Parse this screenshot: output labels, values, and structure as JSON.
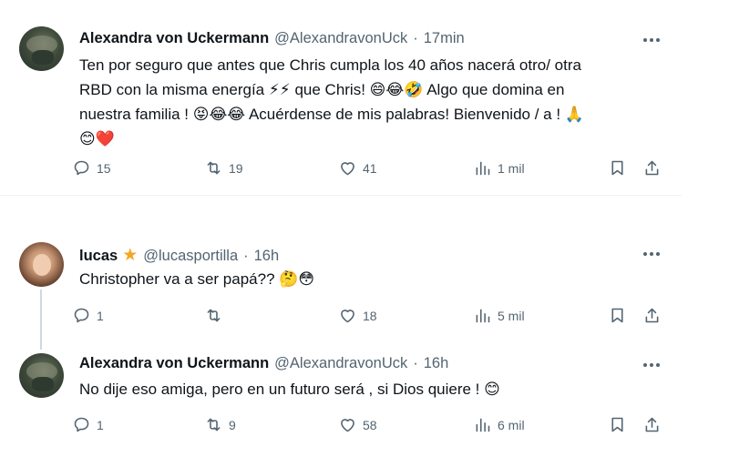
{
  "tweets": [
    {
      "name": "Alexandra von Uckermann",
      "handle": "@AlexandravonUck",
      "dot": "·",
      "time": "17min",
      "lines": [
        "Ten por seguro que antes que Chris cumpla los 40 años nacerá otro/ otra",
        "RBD con la misma energía ⚡⚡ que Chris! 😄😂🤣 Algo que domina en",
        "nuestra familia ! 😝😂😂 Acuérdense de mis palabras! Bienvenido / a ! 🙏",
        "😊❤️"
      ],
      "replies": "15",
      "retweets": "19",
      "likes": "41",
      "views": "1 mil"
    },
    {
      "name": "lucas",
      "verified_star": "★",
      "handle": "@lucasportilla",
      "dot": "·",
      "time": "16h",
      "lines": [
        "Christopher va a ser papá?? 🤔😳"
      ],
      "replies": "1",
      "retweets": "",
      "likes": "18",
      "views": "5 mil"
    },
    {
      "name": "Alexandra von Uckermann",
      "handle": "@AlexandravonUck",
      "dot": "·",
      "time": "16h",
      "lines": [
        "No dije eso amiga, pero en un futuro será , si Dios quiere ! 😊"
      ],
      "replies": "1",
      "retweets": "9",
      "likes": "58",
      "views": "6 mil"
    }
  ],
  "icons": {
    "reply": "reply-icon",
    "retweet": "retweet-icon",
    "like": "heart-icon",
    "views": "views-icon",
    "bookmark": "bookmark-icon",
    "share": "share-icon",
    "more": "more-icon"
  },
  "colors": {
    "text": "#0f1419",
    "secondary": "#536471",
    "star": "#f5a623",
    "separator": "#eff3f4",
    "thread_line": "#cfd9de"
  }
}
